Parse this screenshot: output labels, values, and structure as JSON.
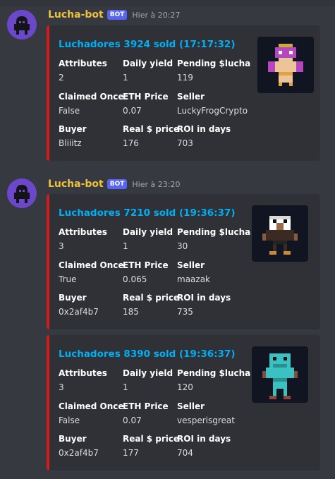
{
  "messages": [
    {
      "author": "Lucha-bot",
      "bot_tag": "BOT",
      "timestamp": "Hier à 20:27",
      "embeds": [
        {
          "title": "Luchadores 3924 sold (17:17:32)",
          "accent_color": "#d11c1c",
          "fields": [
            {
              "name": "Attributes",
              "value": "2"
            },
            {
              "name": "Daily yield",
              "value": "1"
            },
            {
              "name": "Pending $lucha",
              "value": "119"
            },
            {
              "name": "Claimed Once",
              "value": "False"
            },
            {
              "name": "ETH Price",
              "value": "0.07"
            },
            {
              "name": "Seller",
              "value": "LuckyFrogCrypto"
            },
            {
              "name": "Buyer",
              "value": "Bliiitz"
            },
            {
              "name": "Real $ price",
              "value": "176"
            },
            {
              "name": "ROI in days",
              "value": "703"
            }
          ]
        }
      ]
    },
    {
      "author": "Lucha-bot",
      "bot_tag": "BOT",
      "timestamp": "Hier à 23:20",
      "embeds": [
        {
          "title": "Luchadores 7210 sold (19:36:37)",
          "accent_color": "#d11c1c",
          "fields": [
            {
              "name": "Attributes",
              "value": "3"
            },
            {
              "name": "Daily yield",
              "value": "1"
            },
            {
              "name": "Pending $lucha",
              "value": "30"
            },
            {
              "name": "Claimed Once",
              "value": "True"
            },
            {
              "name": "ETH Price",
              "value": "0.065"
            },
            {
              "name": "Seller",
              "value": "maazak"
            },
            {
              "name": "Buyer",
              "value": "0x2af4b7"
            },
            {
              "name": "Real $ price",
              "value": "185"
            },
            {
              "name": "ROI in days",
              "value": "735"
            }
          ]
        },
        {
          "title": "Luchadores 8390 sold (19:36:37)",
          "accent_color": "#d11c1c",
          "fields": [
            {
              "name": "Attributes",
              "value": "3"
            },
            {
              "name": "Daily yield",
              "value": "1"
            },
            {
              "name": "Pending $lucha",
              "value": "120"
            },
            {
              "name": "Claimed Once",
              "value": "False"
            },
            {
              "name": "ETH Price",
              "value": "0.07"
            },
            {
              "name": "Seller",
              "value": "vesperisgreat"
            },
            {
              "name": "Buyer",
              "value": "0x2af4b7"
            },
            {
              "name": "Real $ price",
              "value": "177"
            },
            {
              "name": "ROI in days",
              "value": "704"
            }
          ]
        }
      ]
    }
  ]
}
